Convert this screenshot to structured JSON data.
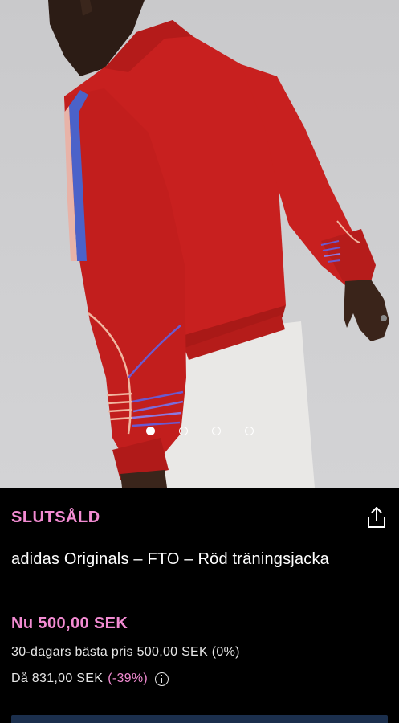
{
  "product": {
    "status": "SLUTSÅLD",
    "title": "adidas Originals – FTO – Röd träningsjacka",
    "price_now": "Nu 500,00 SEK",
    "best_price_30d": "30-dagars bästa pris 500,00 SEK (0%)",
    "was_price": "Då 831,00 SEK",
    "discount": "(-39%)"
  },
  "gallery": {
    "image_count": 4,
    "active_index": 0
  },
  "icons": {
    "share": "share-icon",
    "info": "info-icon"
  },
  "colors": {
    "accent_pink": "#f28bd2",
    "background": "#000000",
    "jacket_red": "#c8201f",
    "bar_navy": "#1b2f4d"
  }
}
